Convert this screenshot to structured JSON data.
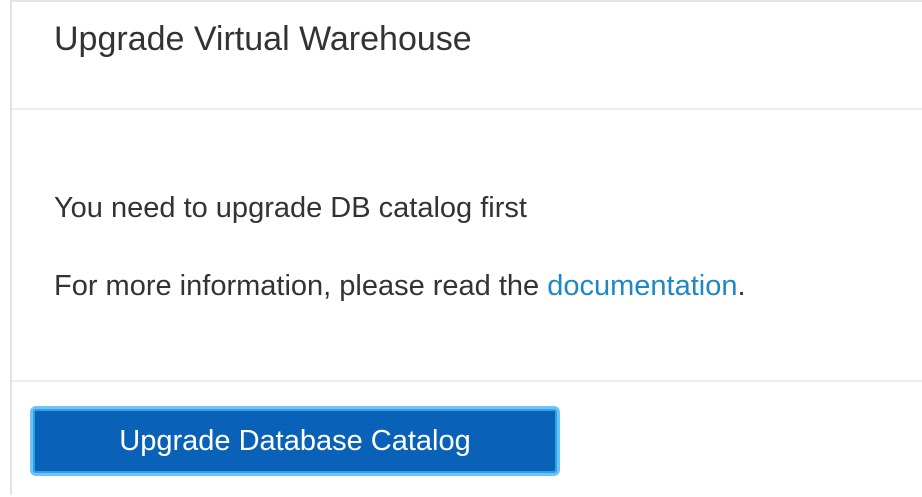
{
  "dialog": {
    "title": "Upgrade Virtual Warehouse",
    "message": "You need to upgrade DB catalog first",
    "info_prefix": "For more information, please read the ",
    "info_link": "documentation",
    "info_suffix": ".",
    "primary_button": "Upgrade Database Catalog"
  },
  "colors": {
    "link": "#1e88c7",
    "button_bg": "#0a62b8",
    "button_focus_ring": "#6fc3f5"
  }
}
